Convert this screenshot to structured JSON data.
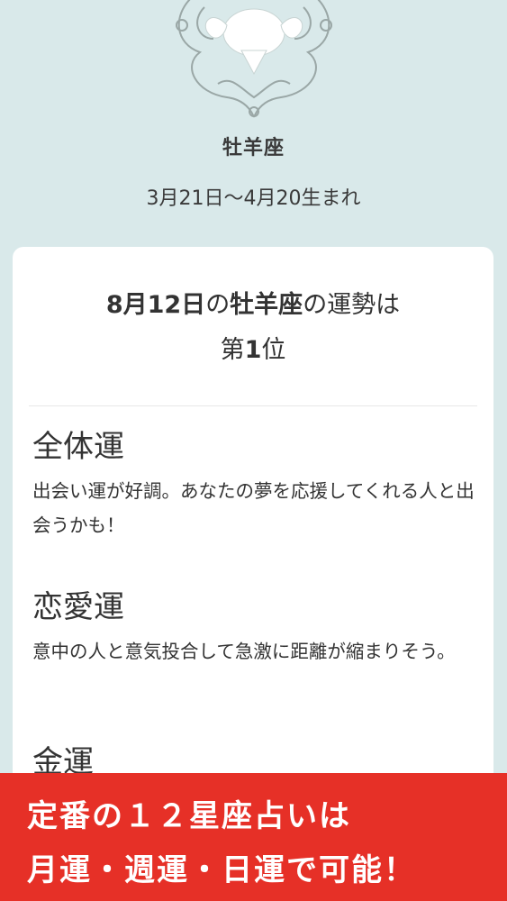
{
  "header": {
    "sign_name": "牡羊座",
    "date_range": "3月21日〜4月20生まれ",
    "emblem_icon": "aries-ram-emblem-icon"
  },
  "ranking": {
    "date": "8月12日",
    "connector": "の",
    "sign": "牡羊座",
    "suffix": "の運勢は",
    "rank_prefix": "第",
    "rank_number": "1",
    "rank_suffix": "位"
  },
  "sections": [
    {
      "title": "全体運",
      "body": "出会い運が好調。あなたの夢を応援してくれる人と出会うかも！"
    },
    {
      "title": "恋愛運",
      "body": "意中の人と意気投合して急激に距離が縮まりそう。"
    },
    {
      "title": "金運",
      "body": ""
    }
  ],
  "banner": {
    "line1": "定番の１２星座占いは",
    "line2": "月運・週運・日運で可能！",
    "color": "#e63027"
  },
  "colors": {
    "background": "#d9e9ea",
    "card": "#ffffff",
    "text": "#333333"
  }
}
